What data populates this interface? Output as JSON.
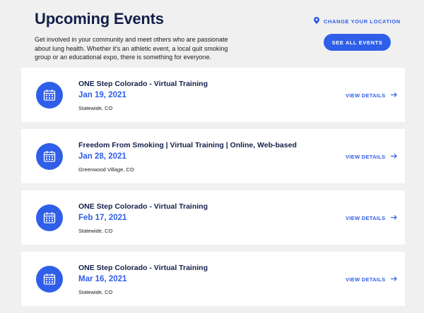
{
  "header": {
    "title": "Upcoming Events",
    "intro": "Get involved in your community and meet others who are passionate about lung health. Whether it's an athletic event, a local quit smoking group or an educational expo, there is something for everyone.",
    "change_location_label": "CHANGE YOUR LOCATION",
    "see_all_label": "SEE ALL EVENTS"
  },
  "view_details_label": "VIEW DETAILS",
  "events": [
    {
      "title": "ONE Step Colorado - Virtual Training",
      "date": "Jan 19, 2021",
      "location": "Statewide, CO"
    },
    {
      "title": "Freedom From Smoking | Virtual Training | Online, Web-based",
      "date": "Jan 28, 2021",
      "location": "Greenwood Village, CO"
    },
    {
      "title": "ONE Step Colorado - Virtual Training",
      "date": "Feb 17, 2021",
      "location": "Statewide, CO"
    },
    {
      "title": "ONE Step Colorado - Virtual Training",
      "date": "Mar 16, 2021",
      "location": "Statewide, CO"
    }
  ],
  "colors": {
    "accent": "#2f5ee8",
    "heading": "#13204a",
    "background": "#f0f0f0",
    "card": "#ffffff"
  },
  "icons": {
    "location": "map-pin-icon",
    "event": "calendar-icon",
    "details": "arrow-right-icon"
  }
}
